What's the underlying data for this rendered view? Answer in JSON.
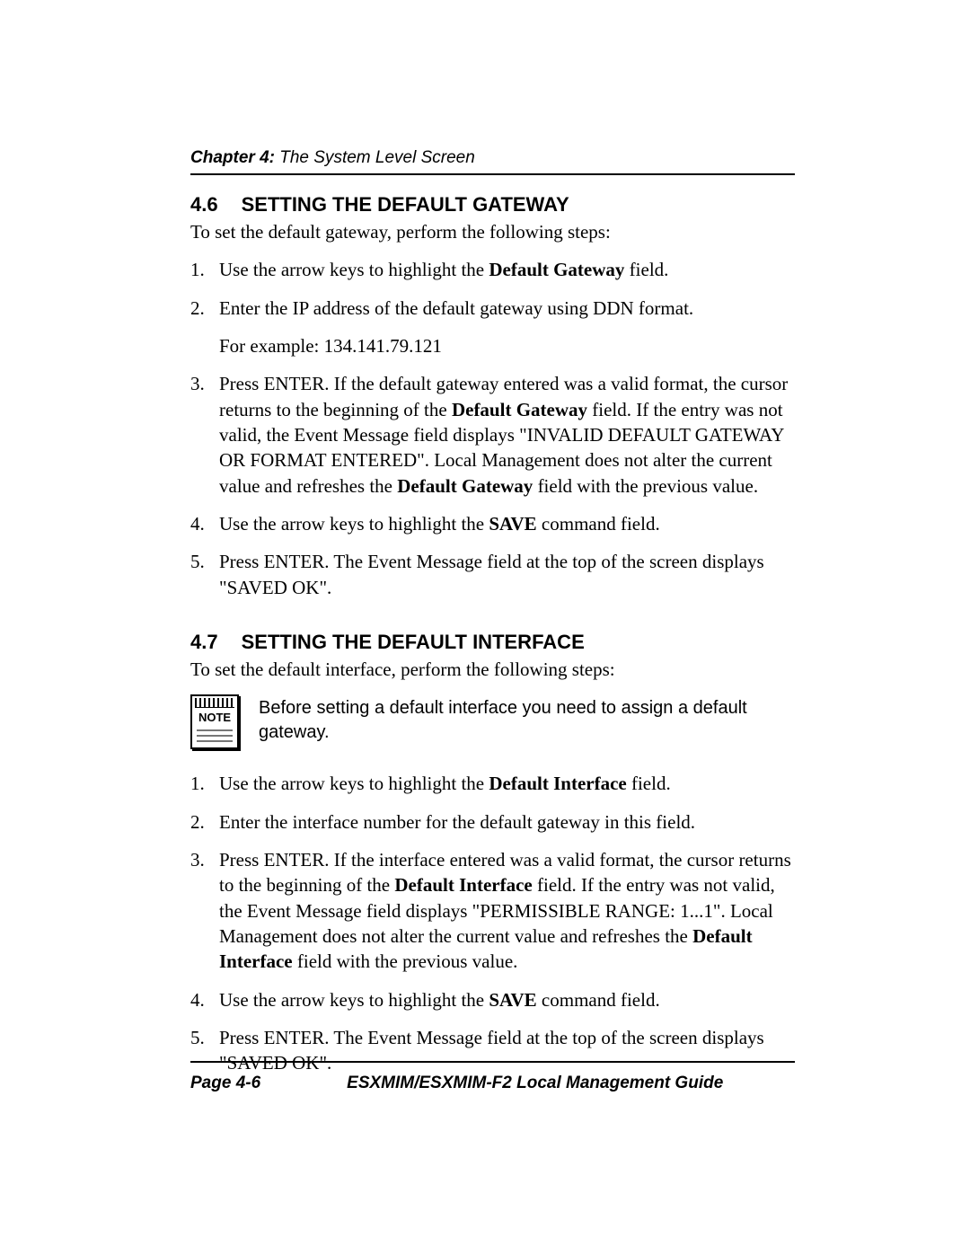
{
  "chapter": {
    "label": "Chapter 4:",
    "title": " The System Level Screen"
  },
  "section46": {
    "number": "4.6",
    "title": "SETTING THE DEFAULT GATEWAY",
    "intro": "To set the default gateway, perform the following steps:",
    "step1_a": "Use the arrow keys to highlight the ",
    "step1_b": "Default Gateway",
    "step1_c": " field.",
    "step2": "Enter the IP address of the default gateway using DDN format.",
    "step2_ex": "For example: 134.141.79.121",
    "step3_a": "Press ENTER. If the default gateway entered was a valid format, the cursor returns to the beginning of the ",
    "step3_b": "Default Gateway",
    "step3_c": " field. If the entry was not valid, the Event Message field displays \"INVALID DEFAULT GATEWAY OR FORMAT ENTERED\". Local Management does not alter the current value and refreshes the ",
    "step3_d": "Default Gateway",
    "step3_e": " field with the previous value.",
    "step4_a": "Use the arrow keys to highlight the ",
    "step4_b": "SAVE",
    "step4_c": " command field.",
    "step5": "Press ENTER. The Event Message field at the top of the screen displays \"SAVED OK\"."
  },
  "section47": {
    "number": "4.7",
    "title": "SETTING THE DEFAULT INTERFACE",
    "intro": "To set the default interface, perform the following steps:",
    "note_label": "NOTE",
    "note_text": "Before setting a default interface you need to assign a default gateway.",
    "step1_a": "Use the arrow keys to highlight the ",
    "step1_b": "Default Interface",
    "step1_c": " field.",
    "step2": "Enter the interface number for the default gateway in this field.",
    "step3_a": "Press ENTER. If the interface entered was a valid format, the cursor returns to the beginning of the ",
    "step3_b": "Default Interface",
    "step3_c": " field. If the entry was not valid, the Event Message field displays \"PERMISSIBLE RANGE: 1...1\". Local Management does not alter the current value and refreshes the ",
    "step3_d": "Default Interface",
    "step3_e": " field with the previous value.",
    "step4_a": "Use the arrow keys to highlight the ",
    "step4_b": "SAVE",
    "step4_c": " command field.",
    "step5": "Press ENTER. The Event Message field at the top of the screen displays \"SAVED OK\"."
  },
  "footer": {
    "page": "Page 4-6",
    "doc": "ESXMIM/ESXMIM-F2 Local Management Guide"
  }
}
